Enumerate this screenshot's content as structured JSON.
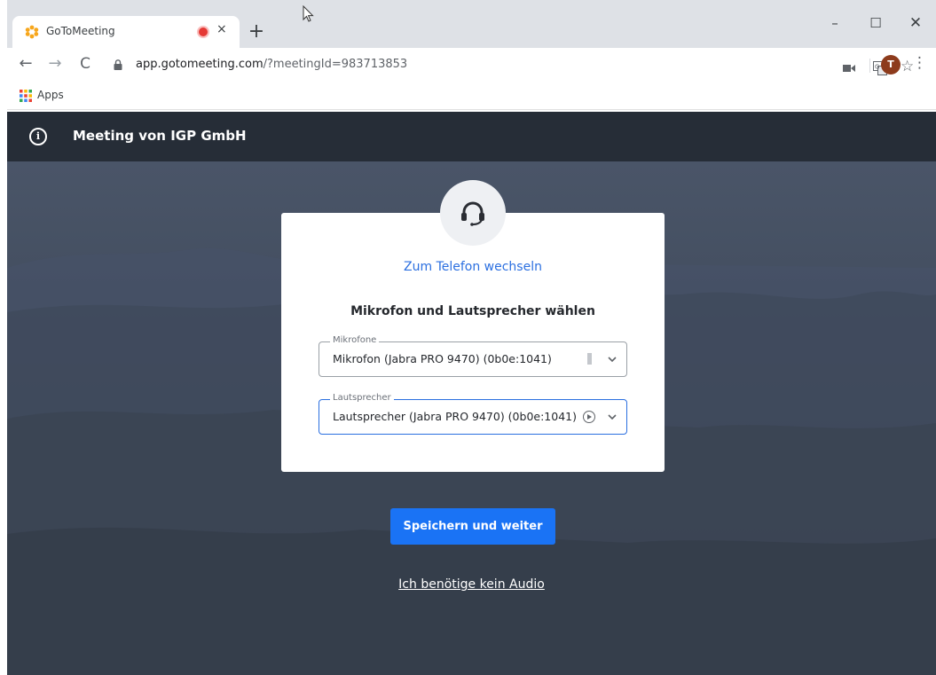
{
  "browser": {
    "tab": {
      "title": "GoToMeeting",
      "favicon": "gotomeeting-flower-icon",
      "recording_indicator": "recording-dot-icon",
      "close_label": "×"
    },
    "new_tab_label": "+",
    "window_controls": {
      "minimize": "–",
      "maximize": "☐",
      "close": "✕"
    },
    "nav": {
      "back": "←",
      "forward": "→",
      "reload": "C"
    },
    "url_host": "app.gotomeeting.com",
    "url_rest": "/?meetingId=983713853",
    "avatar_initial": "T",
    "menu_label": "⋮",
    "star_label": "☆",
    "bookmarks": {
      "apps_label": "Apps"
    }
  },
  "app": {
    "header": {
      "info_label": "i",
      "title": "Meeting von IGP GmbH"
    },
    "dialog": {
      "switch_link": "Zum Telefon wechseln",
      "heading": "Mikrofon und Lautsprecher wählen",
      "microphone": {
        "legend": "Mikrofone",
        "value": "Mikrofon (Jabra PRO 9470) (0b0e:1041)"
      },
      "speaker": {
        "legend": "Lautsprecher",
        "value": "Lautsprecher (Jabra PRO 9470) (0b0e:1041)"
      }
    },
    "save_button": "Speichern und weiter",
    "no_audio_link": "Ich benötige kein Audio"
  },
  "colors": {
    "accent": "#1a73f5",
    "link": "#2b6fe0",
    "header_bg": "#262d37",
    "main_bg": "#434d5f",
    "record": "#e53935",
    "avatar": "#8d3b1c"
  }
}
